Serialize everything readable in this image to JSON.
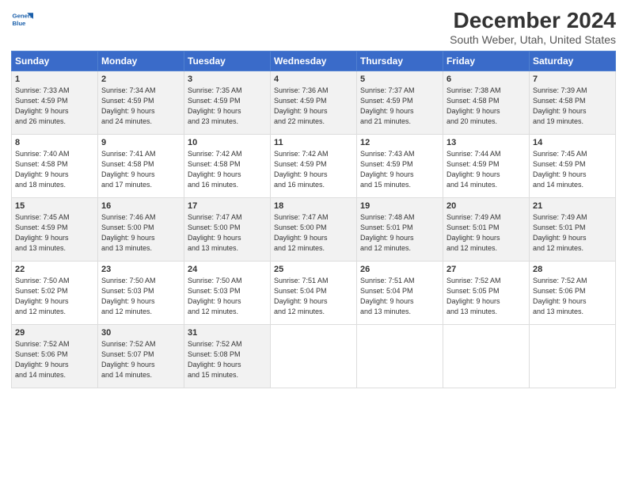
{
  "header": {
    "logo_line1": "General",
    "logo_line2": "Blue",
    "title": "December 2024",
    "subtitle": "South Weber, Utah, United States"
  },
  "days_header": [
    "Sunday",
    "Monday",
    "Tuesday",
    "Wednesday",
    "Thursday",
    "Friday",
    "Saturday"
  ],
  "weeks": [
    [
      {
        "day": "1",
        "info": "Sunrise: 7:33 AM\nSunset: 4:59 PM\nDaylight: 9 hours\nand 26 minutes."
      },
      {
        "day": "2",
        "info": "Sunrise: 7:34 AM\nSunset: 4:59 PM\nDaylight: 9 hours\nand 24 minutes."
      },
      {
        "day": "3",
        "info": "Sunrise: 7:35 AM\nSunset: 4:59 PM\nDaylight: 9 hours\nand 23 minutes."
      },
      {
        "day": "4",
        "info": "Sunrise: 7:36 AM\nSunset: 4:59 PM\nDaylight: 9 hours\nand 22 minutes."
      },
      {
        "day": "5",
        "info": "Sunrise: 7:37 AM\nSunset: 4:59 PM\nDaylight: 9 hours\nand 21 minutes."
      },
      {
        "day": "6",
        "info": "Sunrise: 7:38 AM\nSunset: 4:58 PM\nDaylight: 9 hours\nand 20 minutes."
      },
      {
        "day": "7",
        "info": "Sunrise: 7:39 AM\nSunset: 4:58 PM\nDaylight: 9 hours\nand 19 minutes."
      }
    ],
    [
      {
        "day": "8",
        "info": "Sunrise: 7:40 AM\nSunset: 4:58 PM\nDaylight: 9 hours\nand 18 minutes."
      },
      {
        "day": "9",
        "info": "Sunrise: 7:41 AM\nSunset: 4:58 PM\nDaylight: 9 hours\nand 17 minutes."
      },
      {
        "day": "10",
        "info": "Sunrise: 7:42 AM\nSunset: 4:58 PM\nDaylight: 9 hours\nand 16 minutes."
      },
      {
        "day": "11",
        "info": "Sunrise: 7:42 AM\nSunset: 4:59 PM\nDaylight: 9 hours\nand 16 minutes."
      },
      {
        "day": "12",
        "info": "Sunrise: 7:43 AM\nSunset: 4:59 PM\nDaylight: 9 hours\nand 15 minutes."
      },
      {
        "day": "13",
        "info": "Sunrise: 7:44 AM\nSunset: 4:59 PM\nDaylight: 9 hours\nand 14 minutes."
      },
      {
        "day": "14",
        "info": "Sunrise: 7:45 AM\nSunset: 4:59 PM\nDaylight: 9 hours\nand 14 minutes."
      }
    ],
    [
      {
        "day": "15",
        "info": "Sunrise: 7:45 AM\nSunset: 4:59 PM\nDaylight: 9 hours\nand 13 minutes."
      },
      {
        "day": "16",
        "info": "Sunrise: 7:46 AM\nSunset: 5:00 PM\nDaylight: 9 hours\nand 13 minutes."
      },
      {
        "day": "17",
        "info": "Sunrise: 7:47 AM\nSunset: 5:00 PM\nDaylight: 9 hours\nand 13 minutes."
      },
      {
        "day": "18",
        "info": "Sunrise: 7:47 AM\nSunset: 5:00 PM\nDaylight: 9 hours\nand 12 minutes."
      },
      {
        "day": "19",
        "info": "Sunrise: 7:48 AM\nSunset: 5:01 PM\nDaylight: 9 hours\nand 12 minutes."
      },
      {
        "day": "20",
        "info": "Sunrise: 7:49 AM\nSunset: 5:01 PM\nDaylight: 9 hours\nand 12 minutes."
      },
      {
        "day": "21",
        "info": "Sunrise: 7:49 AM\nSunset: 5:01 PM\nDaylight: 9 hours\nand 12 minutes."
      }
    ],
    [
      {
        "day": "22",
        "info": "Sunrise: 7:50 AM\nSunset: 5:02 PM\nDaylight: 9 hours\nand 12 minutes."
      },
      {
        "day": "23",
        "info": "Sunrise: 7:50 AM\nSunset: 5:03 PM\nDaylight: 9 hours\nand 12 minutes."
      },
      {
        "day": "24",
        "info": "Sunrise: 7:50 AM\nSunset: 5:03 PM\nDaylight: 9 hours\nand 12 minutes."
      },
      {
        "day": "25",
        "info": "Sunrise: 7:51 AM\nSunset: 5:04 PM\nDaylight: 9 hours\nand 12 minutes."
      },
      {
        "day": "26",
        "info": "Sunrise: 7:51 AM\nSunset: 5:04 PM\nDaylight: 9 hours\nand 13 minutes."
      },
      {
        "day": "27",
        "info": "Sunrise: 7:52 AM\nSunset: 5:05 PM\nDaylight: 9 hours\nand 13 minutes."
      },
      {
        "day": "28",
        "info": "Sunrise: 7:52 AM\nSunset: 5:06 PM\nDaylight: 9 hours\nand 13 minutes."
      }
    ],
    [
      {
        "day": "29",
        "info": "Sunrise: 7:52 AM\nSunset: 5:06 PM\nDaylight: 9 hours\nand 14 minutes."
      },
      {
        "day": "30",
        "info": "Sunrise: 7:52 AM\nSunset: 5:07 PM\nDaylight: 9 hours\nand 14 minutes."
      },
      {
        "day": "31",
        "info": "Sunrise: 7:52 AM\nSunset: 5:08 PM\nDaylight: 9 hours\nand 15 minutes."
      },
      null,
      null,
      null,
      null
    ]
  ]
}
